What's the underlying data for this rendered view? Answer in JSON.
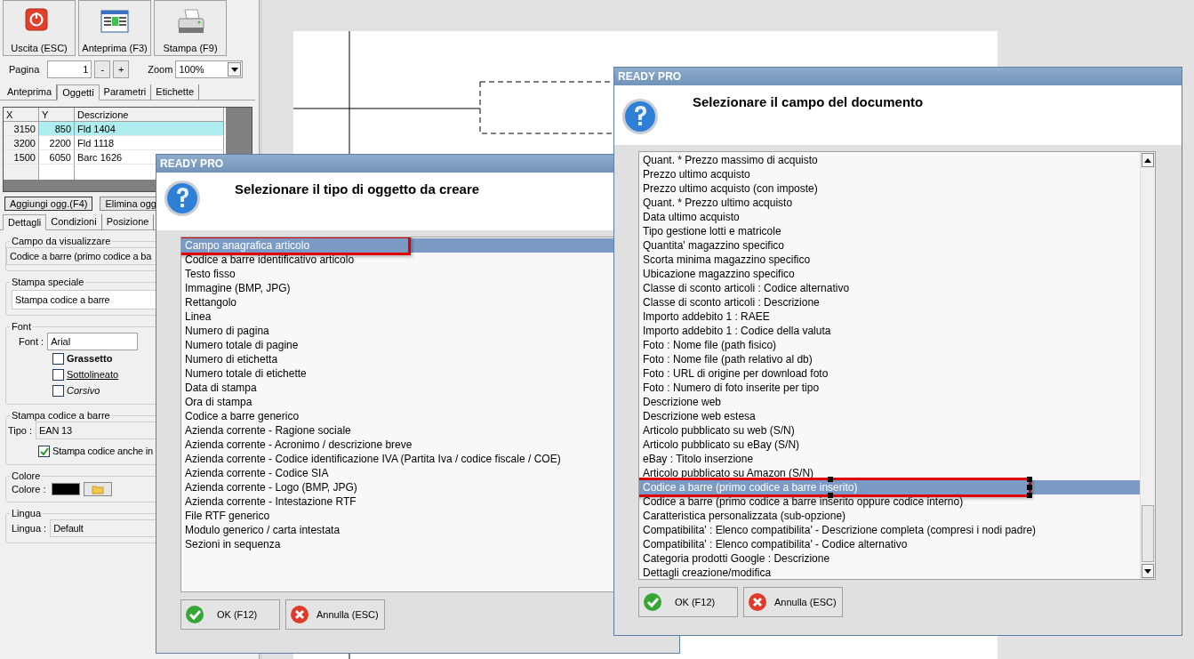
{
  "toolbar": {
    "buttons": [
      {
        "label": "Uscita (ESC)"
      },
      {
        "label": "Anteprima (F3)"
      },
      {
        "label": "Stampa (F9)"
      }
    ]
  },
  "pager": {
    "label": "Pagina",
    "value": "1",
    "buttons": [
      "-",
      "+"
    ],
    "zoom_label": "Zoom",
    "zoom_value": "100%"
  },
  "tabs": [
    {
      "label": "Anteprima",
      "selected": false
    },
    {
      "label": "Oggetti",
      "selected": true
    },
    {
      "label": "Parametri",
      "selected": false
    },
    {
      "label": "Etichette",
      "selected": false
    }
  ],
  "objects_table": {
    "columns": [
      "X",
      "Y",
      "Descrizione"
    ],
    "rows": [
      {
        "cells": [
          "3150",
          "850",
          "Fld 1404"
        ],
        "selected": true
      },
      {
        "cells": [
          "3200",
          "2200",
          "Fld 1118"
        ],
        "selected": false
      },
      {
        "cells": [
          "1500",
          "6050",
          "Barc 1626"
        ],
        "selected": false
      }
    ]
  },
  "actions": [
    "Aggiungi ogg.(F4)",
    "Elimina ogg"
  ],
  "detail_tabs": [
    {
      "label": "Dettagli",
      "selected": true
    },
    {
      "label": "Condizioni",
      "selected": false
    },
    {
      "label": "Posizione",
      "selected": false
    }
  ],
  "field_group": {
    "title": "Campo da visualizzare",
    "value": "Codice a barre (primo codice a ba"
  },
  "special_group": {
    "title": "Stampa speciale",
    "value": "Stampa codice a barre"
  },
  "font_group": {
    "title": "Font",
    "label": "Font :",
    "value": "Arial",
    "options": [
      {
        "label": "Grassetto",
        "kind": "bold",
        "checked": false
      },
      {
        "label": "Sottolineato",
        "kind": "underline",
        "checked": false
      },
      {
        "label": "Corsivo",
        "kind": "italic",
        "checked": false
      }
    ]
  },
  "barcode_group": {
    "title": "Stampa codice a barre",
    "label": "Tipo :",
    "value": "EAN 13",
    "option": {
      "label": "Stampa codice anche in",
      "checked": true
    }
  },
  "color_group": {
    "title": "Colore",
    "label": "Colore :",
    "color": "#000000"
  },
  "language_group": {
    "title": "Lingua",
    "label": "Lingua :",
    "value": "Default"
  },
  "dialogs": [
    {
      "title": "READY PRO",
      "heading": "Selezionare il tipo di oggetto da creare",
      "scrollbar": false,
      "frame_handles": false,
      "items": [
        {
          "label": "Campo anagrafica articolo",
          "selected": true,
          "framed": true
        },
        {
          "label": "Codice a barre identificativo articolo",
          "selected": false,
          "framed": false
        },
        {
          "label": "Testo fisso",
          "selected": false,
          "framed": false
        },
        {
          "label": "Immagine (BMP, JPG)",
          "selected": false,
          "framed": false
        },
        {
          "label": "Rettangolo",
          "selected": false,
          "framed": false
        },
        {
          "label": "Linea",
          "selected": false,
          "framed": false
        },
        {
          "label": "Numero di pagina",
          "selected": false,
          "framed": false
        },
        {
          "label": "Numero totale di pagine",
          "selected": false,
          "framed": false
        },
        {
          "label": "Numero di etichetta",
          "selected": false,
          "framed": false
        },
        {
          "label": "Numero totale di etichette",
          "selected": false,
          "framed": false
        },
        {
          "label": "Data di stampa",
          "selected": false,
          "framed": false
        },
        {
          "label": "Ora di stampa",
          "selected": false,
          "framed": false
        },
        {
          "label": "Codice a barre generico",
          "selected": false,
          "framed": false
        },
        {
          "label": "Azienda corrente - Ragione sociale",
          "selected": false,
          "framed": false
        },
        {
          "label": "Azienda corrente - Acronimo / descrizione breve",
          "selected": false,
          "framed": false
        },
        {
          "label": "Azienda corrente - Codice identificazione IVA (Partita Iva / codice fiscale / COE)",
          "selected": false,
          "framed": false
        },
        {
          "label": "Azienda corrente - Codice SIA",
          "selected": false,
          "framed": false
        },
        {
          "label": "Azienda corrente - Logo (BMP, JPG)",
          "selected": false,
          "framed": false
        },
        {
          "label": "Azienda corrente - Intestazione RTF",
          "selected": false,
          "framed": false
        },
        {
          "label": "File RTF generico",
          "selected": false,
          "framed": false
        },
        {
          "label": "Modulo generico / carta intestata",
          "selected": false,
          "framed": false
        },
        {
          "label": "Sezioni in sequenza",
          "selected": false,
          "framed": false
        }
      ],
      "buttons": [
        {
          "label": "OK (F12)",
          "kind": "ok"
        },
        {
          "label": "Annulla (ESC)",
          "kind": "cancel"
        }
      ]
    },
    {
      "title": "READY PRO",
      "heading": "Selezionare il campo del documento",
      "scrollbar": true,
      "frame_handles": true,
      "items": [
        {
          "label": "Quant. * Prezzo massimo di acquisto",
          "selected": false,
          "framed": false
        },
        {
          "label": "Prezzo ultimo acquisto",
          "selected": false,
          "framed": false
        },
        {
          "label": "Prezzo ultimo acquisto (con imposte)",
          "selected": false,
          "framed": false
        },
        {
          "label": "Quant. * Prezzo ultimo acquisto",
          "selected": false,
          "framed": false
        },
        {
          "label": "Data ultimo acquisto",
          "selected": false,
          "framed": false
        },
        {
          "label": "Tipo gestione lotti e matricole",
          "selected": false,
          "framed": false
        },
        {
          "label": "Quantita' magazzino specifico",
          "selected": false,
          "framed": false
        },
        {
          "label": "Scorta minima magazzino specifico",
          "selected": false,
          "framed": false
        },
        {
          "label": "Ubicazione magazzino specifico",
          "selected": false,
          "framed": false
        },
        {
          "label": "Classe di sconto articoli : Codice alternativo",
          "selected": false,
          "framed": false
        },
        {
          "label": "Classe di sconto articoli : Descrizione",
          "selected": false,
          "framed": false
        },
        {
          "label": "Importo addebito 1 : RAEE",
          "selected": false,
          "framed": false
        },
        {
          "label": "Importo addebito 1 : Codice della valuta",
          "selected": false,
          "framed": false
        },
        {
          "label": "Foto : Nome file (path fisico)",
          "selected": false,
          "framed": false
        },
        {
          "label": "Foto : Nome file (path relativo al db)",
          "selected": false,
          "framed": false
        },
        {
          "label": "Foto : URL di origine per download foto",
          "selected": false,
          "framed": false
        },
        {
          "label": "Foto : Numero di foto inserite per tipo",
          "selected": false,
          "framed": false
        },
        {
          "label": "Descrizione web",
          "selected": false,
          "framed": false
        },
        {
          "label": "Descrizione web estesa",
          "selected": false,
          "framed": false
        },
        {
          "label": "Articolo pubblicato su web (S/N)",
          "selected": false,
          "framed": false
        },
        {
          "label": "Articolo pubblicato su eBay (S/N)",
          "selected": false,
          "framed": false
        },
        {
          "label": "eBay : Titolo inserzione",
          "selected": false,
          "framed": false
        },
        {
          "label": "Articolo pubblicato su Amazon (S/N)",
          "selected": false,
          "framed": false
        },
        {
          "label": "Codice a barre (primo codice a barre inserito)",
          "selected": true,
          "framed": true
        },
        {
          "label": "Codice a barre (primo codice a barre inserito oppure codice interno)",
          "selected": false,
          "framed": false
        },
        {
          "label": "Caratteristica personalizzata (sub-opzione)",
          "selected": false,
          "framed": false
        },
        {
          "label": "Compatibilita' : Elenco compatibilita' - Descrizione completa (compresi i nodi padre)",
          "selected": false,
          "framed": false
        },
        {
          "label": "Compatibilita' : Elenco compatibilita' - Codice alternativo",
          "selected": false,
          "framed": false
        },
        {
          "label": "Categoria prodotti Google : Descrizione",
          "selected": false,
          "framed": false
        },
        {
          "label": "Dettagli creazione/modifica",
          "selected": false,
          "framed": false
        }
      ],
      "buttons": [
        {
          "label": "OK (F12)",
          "kind": "ok"
        },
        {
          "label": "Annulla (ESC)",
          "kind": "cancel"
        }
      ]
    }
  ]
}
